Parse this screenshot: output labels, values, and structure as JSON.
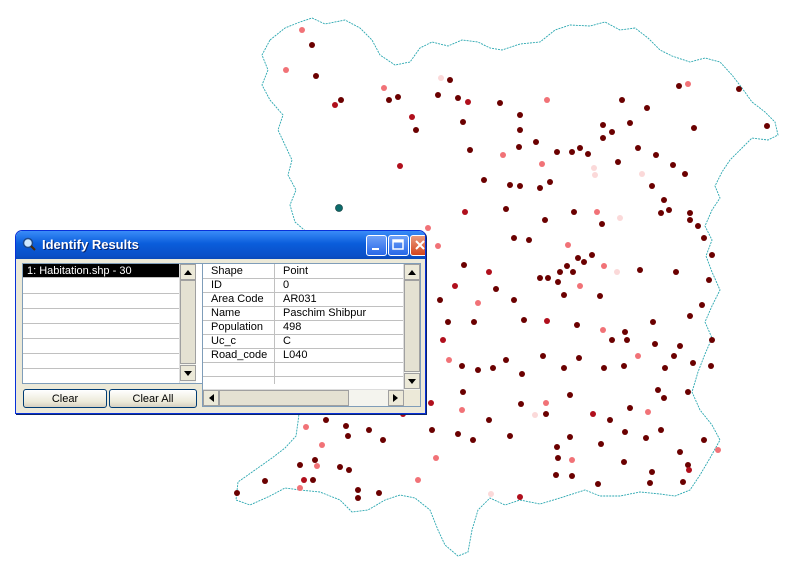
{
  "colors": {
    "boundary": "#2aa7b0",
    "dot_dark": "#6b0000",
    "dot_mid": "#b00f1c",
    "dot_light": "#f17277",
    "dot_pale": "#fbd9d9",
    "selected": "#0b6b6b"
  },
  "window": {
    "title": "Identify Results",
    "icon": "identify-magnifier-icon",
    "minimize_icon": "minimize-icon",
    "maximize_icon": "maximize-icon",
    "close_icon": "close-icon"
  },
  "results": {
    "items": [
      {
        "label": "1:  Habitation.shp - 30",
        "selected": true
      }
    ],
    "clear_label": "Clear",
    "clear_all_label": "Clear All"
  },
  "attributes": {
    "rows": [
      {
        "field": "Shape",
        "value": "Point"
      },
      {
        "field": "ID",
        "value": "0"
      },
      {
        "field": "Area Code",
        "value": "AR031"
      },
      {
        "field": "Name",
        "value": "Paschim Shibpur"
      },
      {
        "field": "Population",
        "value": "498"
      },
      {
        "field": "Uc_c",
        "value": "C"
      },
      {
        "field": "Road_code",
        "value": "L040"
      }
    ]
  },
  "map": {
    "layer": "Habitation.shp"
  }
}
